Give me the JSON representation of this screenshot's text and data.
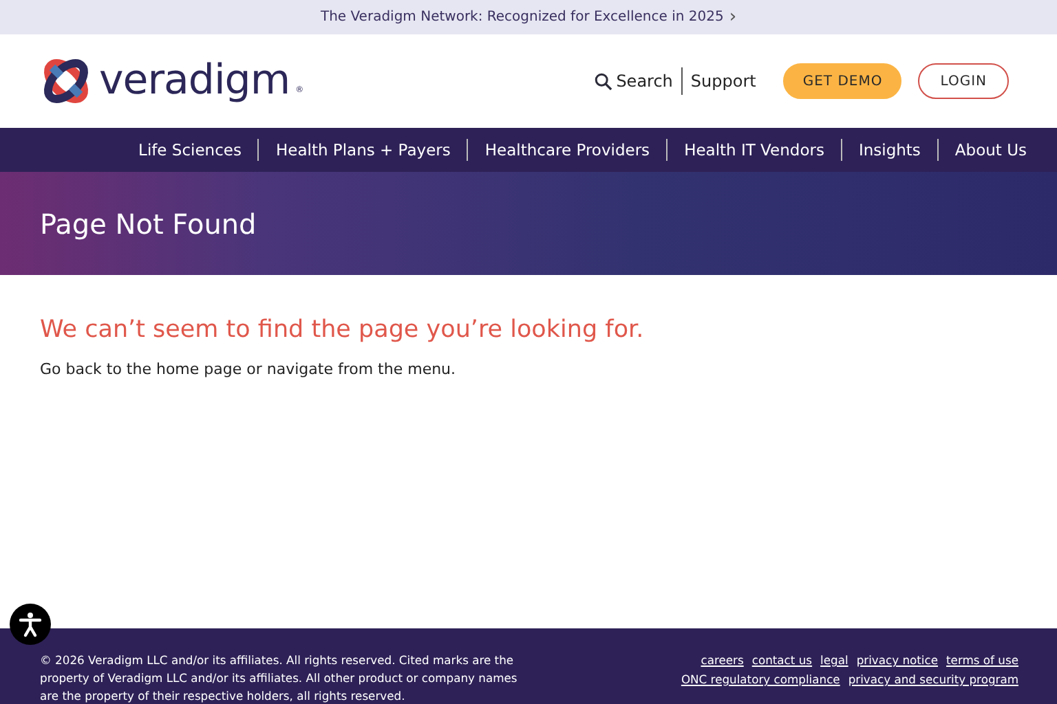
{
  "announcement": {
    "text": "The Veradigm Network: Recognized for Excellence in 2025",
    "arrow": "›"
  },
  "header": {
    "logo_text": "veradigm",
    "logo_mark": "®",
    "search": "Search",
    "support": "Support",
    "buttons": [
      {
        "label": "GET DEMO",
        "kind": "filled"
      },
      {
        "label": "LOGIN",
        "kind": "outline"
      }
    ]
  },
  "nav": {
    "items": [
      "Life Sciences",
      "Health Plans + Payers",
      "Healthcare Providers",
      "Health IT Vendors",
      "Insights",
      "About Us"
    ]
  },
  "hero": {
    "title": "Page Not Found"
  },
  "content": {
    "heading": "We can’t seem to find the page you’re looking for.",
    "body": "Go back to the home page or navigate from the menu."
  },
  "footer": {
    "copyright": "© 2026 Veradigm LLC and/or its affiliates. All rights reserved. Cited marks are the property of Veradigm LLC and/or its affiliates. All other product or company names are the property of their respective holders, all rights reserved.",
    "link_rows": [
      [
        "careers",
        "contact us",
        "legal",
        "privacy notice",
        "terms of use"
      ],
      [
        "ONC regulatory compliance",
        "privacy and security program"
      ]
    ]
  }
}
